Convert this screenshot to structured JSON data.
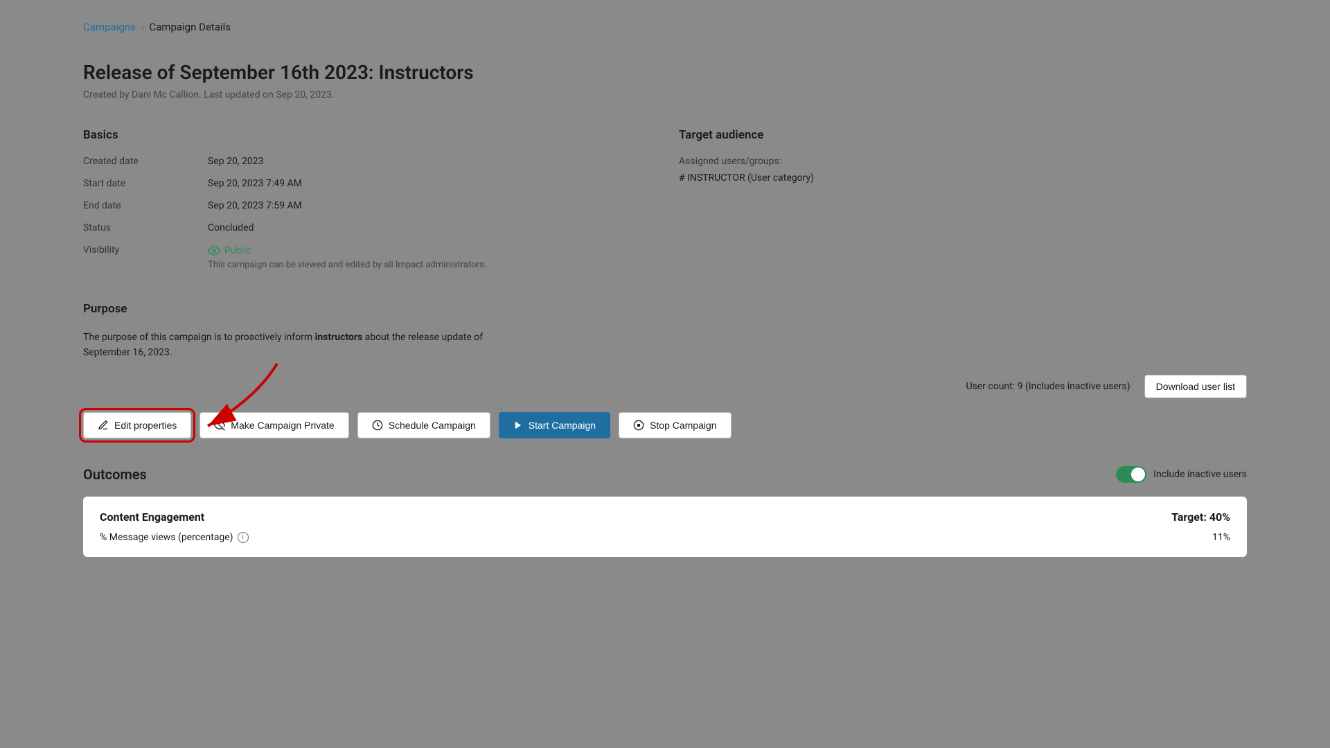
{
  "breadcrumb": {
    "link_label": "Campaigns",
    "separator": "›",
    "current": "Campaign Details"
  },
  "header": {
    "title": "Release of September 16th 2023: Instructors",
    "subtitle": "Created by Dani Mc Callion. Last updated on Sep 20, 2023."
  },
  "basics": {
    "section_title": "Basics",
    "fields": [
      {
        "label": "Created date",
        "value": "Sep 20, 2023"
      },
      {
        "label": "Start date",
        "value": "Sep 20, 2023 7:49 AM"
      },
      {
        "label": "End date",
        "value": "Sep 20, 2023 7:59 AM"
      },
      {
        "label": "Status",
        "value": "Concluded"
      },
      {
        "label": "Visibility",
        "value": "Public"
      }
    ],
    "visibility_note": "This campaign can be viewed and edited by all Impact administrators."
  },
  "target_audience": {
    "section_title": "Target audience",
    "assigned_label": "Assigned users/groups:",
    "category": "# INSTRUCTOR (User category)"
  },
  "purpose": {
    "section_title": "Purpose",
    "text_part1": "The purpose of this campaign is to proactively inform ",
    "text_bold": "instructors",
    "text_part2": " about the release update of September 16, 2023."
  },
  "user_count": {
    "text": "User count: 9 (Includes inactive users)",
    "download_btn_label": "Download user list"
  },
  "action_buttons": {
    "edit_label": "Edit properties",
    "make_private_label": "Make Campaign Private",
    "schedule_label": "Schedule Campaign",
    "start_label": "Start Campaign",
    "stop_label": "Stop Campaign"
  },
  "outcomes": {
    "title": "Outcomes",
    "toggle_label": "Include inactive users",
    "content_engagement": {
      "title": "Content Engagement",
      "target_label": "Target: 40%",
      "metrics": [
        {
          "name": "% Message views (percentage)",
          "value": "11%"
        }
      ]
    }
  }
}
